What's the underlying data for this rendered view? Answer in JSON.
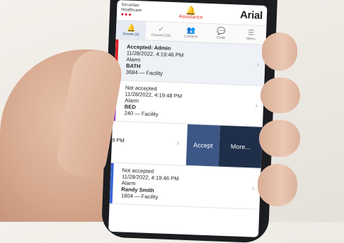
{
  "header": {
    "brand_line1": "Securitas",
    "brand_line2": "Healthcare",
    "brand_dots": "●●●",
    "assistance": "Assistance",
    "logo": "Arial"
  },
  "tabs": [
    {
      "label": "Events (4)",
      "icon": "bell-icon",
      "glyph": "🔔",
      "active": true
    },
    {
      "label": "Cleared (25)",
      "icon": "check-icon",
      "glyph": "✓",
      "active": false
    },
    {
      "label": "Contacts",
      "icon": "contacts-icon",
      "glyph": "👥",
      "active": false
    },
    {
      "label": "Chats",
      "icon": "chat-icon",
      "glyph": "💬",
      "active": false
    },
    {
      "label": "Menu",
      "icon": "menu-icon",
      "glyph": "☰",
      "active": false
    }
  ],
  "events": [
    {
      "status": "Accepted: Admin",
      "time": "11/28/2022, 4:19:46 PM",
      "type": "Alarm",
      "location": "BATH",
      "facility": "3684 — Facility",
      "bar_color": "#e3262b"
    },
    {
      "status": "Not accepted",
      "time": "11/28/2022, 4:19:48 PM",
      "type": "Alarm",
      "location": "BED",
      "facility": "240 — Facility",
      "bar_color": "#8e44c8"
    },
    {
      "partial_time": "9 PM",
      "accept_label": "Accept",
      "more_label": "More..."
    },
    {
      "status": "Not accepted",
      "time": "11/28/2022, 4:19:46 PM",
      "type": "Alarm",
      "location": "Randy Smith",
      "facility": "1804 — Facility",
      "bar_color": "#3a67d6"
    }
  ],
  "colors": {
    "accent": "#2a3f78",
    "accept_button": "#3c5786",
    "more_button": "#1f2f4a",
    "assistance": "#e0302c"
  }
}
